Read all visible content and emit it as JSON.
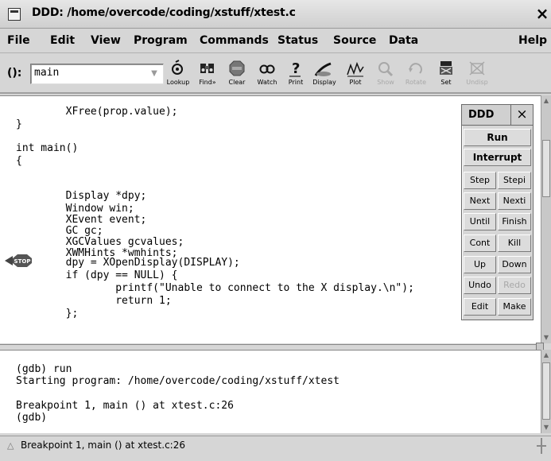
{
  "window": {
    "title": "DDD: /home/overcode/coding/xstuff/xtest.c",
    "close_glyph": "×"
  },
  "menubar": {
    "items": [
      "File",
      "Edit",
      "View",
      "Program",
      "Commands",
      "Status",
      "Source",
      "Data"
    ],
    "help": "Help"
  },
  "toolbar": {
    "arg_label": "():",
    "arg_value": "main",
    "tools": [
      {
        "label": "Lookup",
        "icon": "lookup-icon",
        "enabled": true
      },
      {
        "label": "Find»",
        "icon": "find-icon",
        "enabled": true
      },
      {
        "label": "Clear",
        "icon": "stop-sign-icon",
        "enabled": true
      },
      {
        "label": "Watch",
        "icon": "watch-icon",
        "enabled": true
      },
      {
        "label": "Print",
        "icon": "print-icon",
        "enabled": true
      },
      {
        "label": "Display",
        "icon": "display-icon",
        "enabled": true
      },
      {
        "label": "Plot",
        "icon": "plot-icon",
        "enabled": true
      },
      {
        "label": "Show",
        "icon": "show-icon",
        "enabled": false
      },
      {
        "label": "Rotate",
        "icon": "rotate-icon",
        "enabled": false
      },
      {
        "label": "Set",
        "icon": "set-icon",
        "enabled": true
      },
      {
        "label": "Undisp",
        "icon": "undisp-icon",
        "enabled": false
      }
    ]
  },
  "source": {
    "lines": [
      "        XFree(prop.value);",
      "}",
      "",
      "int main()",
      "{",
      "        Display *dpy;",
      "        Window win;",
      "        XEvent event;",
      "        GC gc;",
      "        XGCValues gcvalues;",
      "        XWMHints *wmhints;",
      "",
      "        dpy = XOpenDisplay(DISPLAY);",
      "        if (dpy == NULL) {",
      "                printf(\"Unable to connect to the X display.\\n\");",
      "                return 1;",
      "        };"
    ],
    "breakpoint_glyph": "STOP"
  },
  "command_tool": {
    "title": "DDD",
    "close_glyph": "×",
    "run": "Run",
    "interrupt": "Interrupt",
    "buttons": [
      [
        "Step",
        "Stepi"
      ],
      [
        "Next",
        "Nexti"
      ],
      [
        "Until",
        "Finish"
      ],
      [
        "Cont",
        "Kill"
      ],
      [
        "Up",
        "Down"
      ],
      [
        "Undo",
        "Redo"
      ],
      [
        "Edit",
        "Make"
      ]
    ]
  },
  "console": {
    "lines": [
      "(gdb) run",
      "Starting program: /home/overcode/coding/xstuff/xtest",
      "",
      "Breakpoint 1, main () at xtest.c:26",
      "(gdb)"
    ]
  },
  "status": {
    "arrow": "△",
    "text": "Breakpoint 1, main () at xtest.c:26"
  },
  "colors": {
    "background": "#d6d6d6",
    "text_area": "#ffffff",
    "disabled": "#a8a8a8",
    "breakpoint": "#555555"
  }
}
